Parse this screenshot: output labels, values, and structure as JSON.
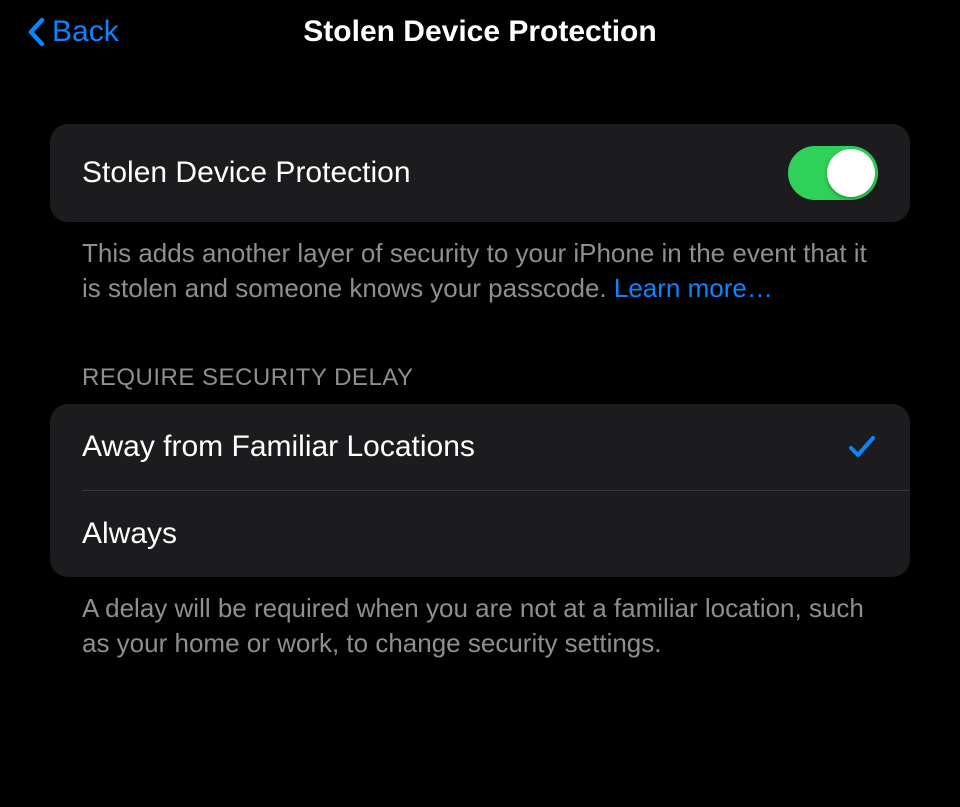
{
  "nav": {
    "back_label": "Back",
    "title": "Stolen Device Protection"
  },
  "protection": {
    "row_label": "Stolen Device Protection",
    "toggle_on": true,
    "footer_text": "This adds another layer of security to your iPhone in the event that it is stolen and someone knows your passcode. ",
    "learn_more": "Learn more…"
  },
  "delay": {
    "header": "Require Security Delay",
    "option_away": "Away from Familiar Locations",
    "option_always": "Always",
    "selected": "away",
    "footer_text": "A delay will be required when you are not at a familiar location, such as your home or work, to change security settings."
  },
  "colors": {
    "accent_blue": "#0a84ff",
    "toggle_green": "#30d158"
  }
}
